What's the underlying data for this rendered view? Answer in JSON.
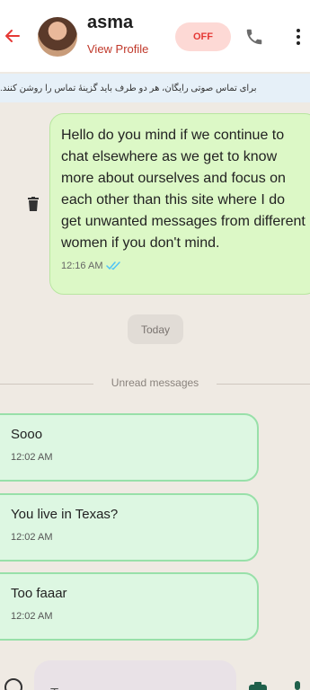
{
  "header": {
    "name": "asma",
    "view_profile": "View Profile",
    "status_pill": "OFF",
    "icons": [
      "back-arrow-icon",
      "avatar",
      "phone-icon",
      "more-vert-icon"
    ]
  },
  "notice": {
    "text": "برای تماس صوتی رایگان، هر دو طرف باید گزینهٔ تماس را روشن کنند."
  },
  "messages": [
    {
      "direction": "outgoing",
      "text": "Hello do you mind if we continue to chat elsewhere as we get to know more about ourselves and focus on each other than this site where I do get unwanted messages from different women if you don't mind.",
      "time": "12:16 AM",
      "status_icon": "double-check-icon"
    }
  ],
  "date_chip": "Today",
  "unread_label": "Unread messages",
  "incoming": [
    {
      "text": "Sooo",
      "time": "12:02 AM"
    },
    {
      "text": "You live in Texas?",
      "time": "12:02 AM"
    },
    {
      "text": "Too faaar",
      "time": "12:02 AM"
    }
  ],
  "composer": {
    "placeholder": "Type a message"
  },
  "colors": {
    "accent_red": "#e53935",
    "outgoing_bubble": "#dcf8c6",
    "incoming_bubble": "#ddf7e2",
    "incoming_border": "#98e0a9",
    "chat_background": "#efeae3",
    "read_tick": "#4fc3f7"
  }
}
